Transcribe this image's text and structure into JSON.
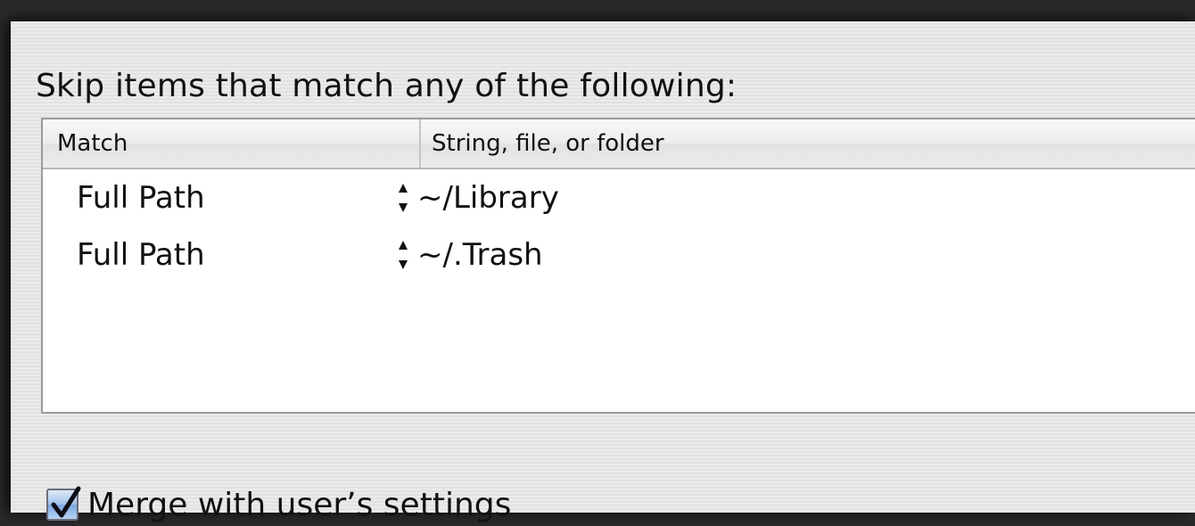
{
  "section": {
    "heading": "Skip items that match any of the following:"
  },
  "table": {
    "columns": [
      "Match",
      "String, file, or folder"
    ],
    "rows": [
      {
        "match": "Full Path",
        "value": "~/Library"
      },
      {
        "match": "Full Path",
        "value": "~/.Trash"
      }
    ]
  },
  "merge": {
    "label": "Merge with user’s settings",
    "checked": true
  },
  "icons": {
    "stepper": "up-down-arrows-icon",
    "check": "checkmark-icon"
  },
  "colors": {
    "panel_bg": "#e7e7e7",
    "checkbox_fill": "#7aa7e0"
  }
}
